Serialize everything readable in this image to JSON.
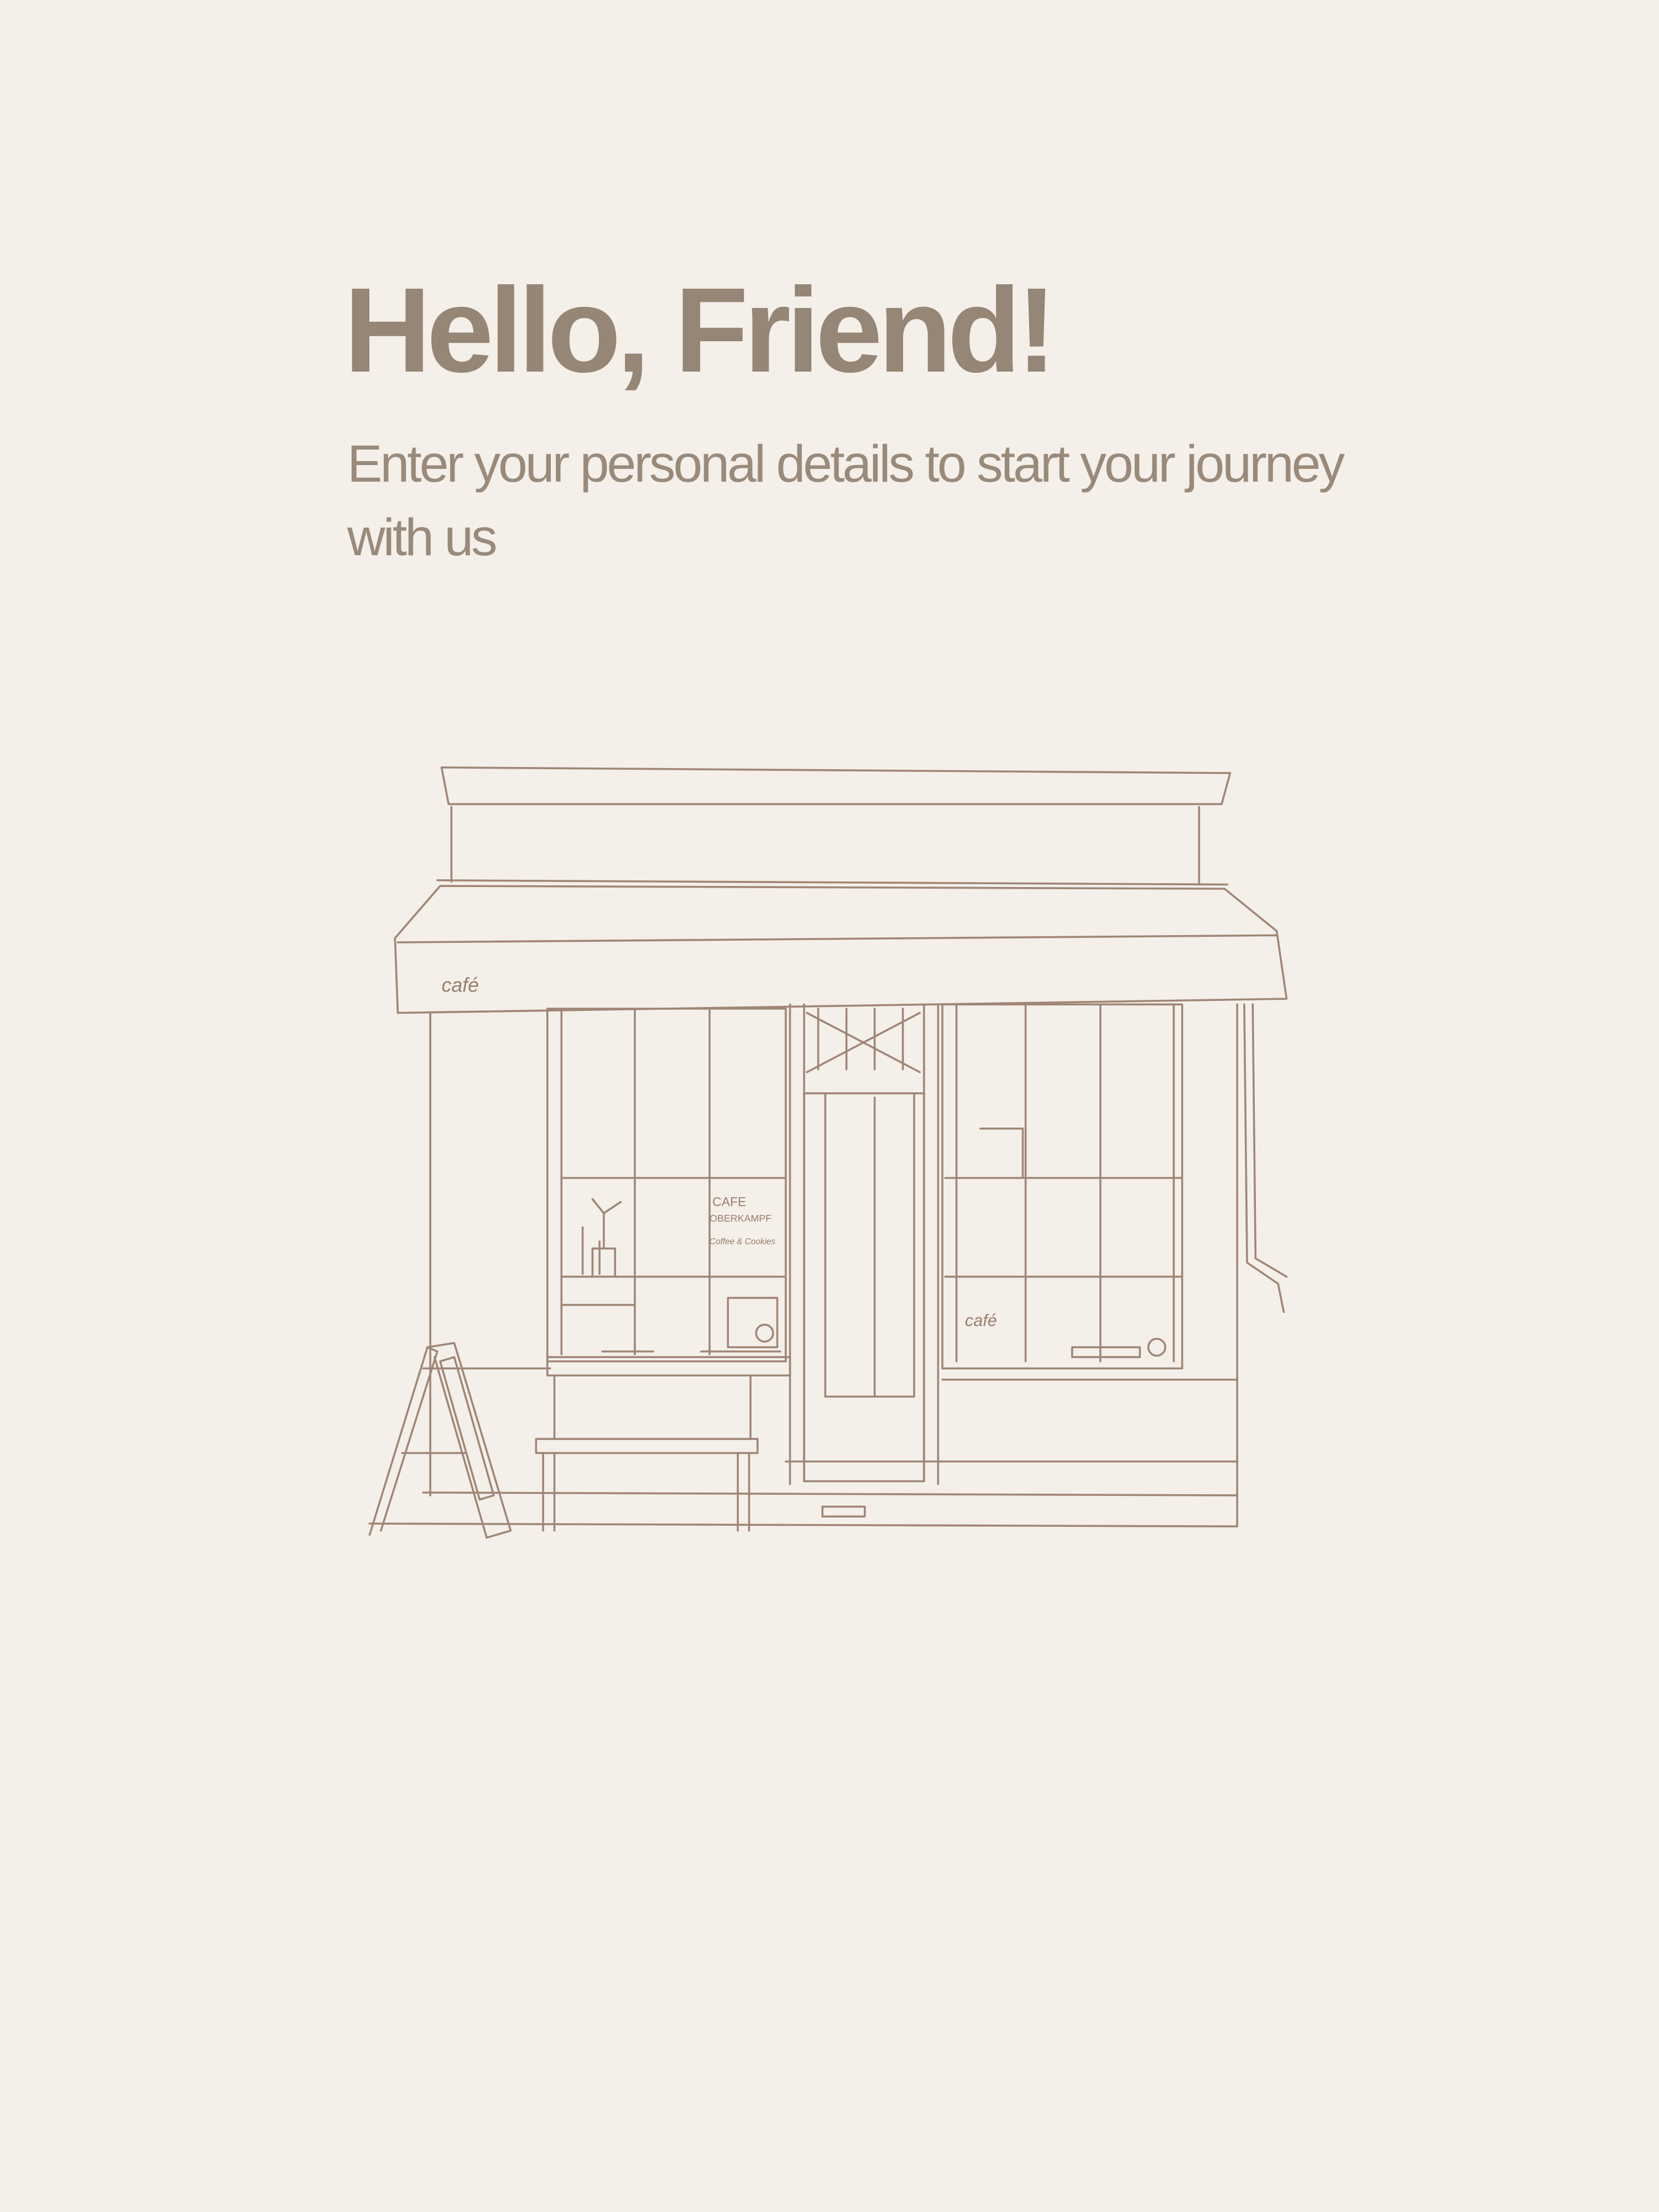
{
  "welcome": {
    "title": "Hello, Friend!",
    "subtitle": "Enter your personal details to start your journey with us"
  },
  "illustration": {
    "awning_logo": "café",
    "window_sign_line1": "CAFE",
    "window_sign_line2": "OBERKAMPF",
    "window_sign_line3": "Coffee & Cookies"
  },
  "colors": {
    "background": "#f4efe9",
    "text": "#968676",
    "line": "#a08676"
  }
}
